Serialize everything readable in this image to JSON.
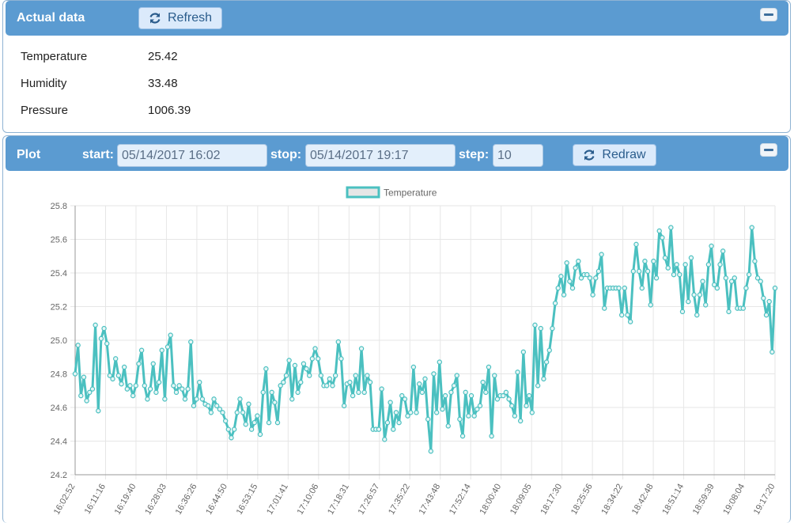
{
  "actual": {
    "title": "Actual data",
    "refresh_label": "Refresh",
    "rows": [
      {
        "label": "Temperature",
        "value": "25.42"
      },
      {
        "label": "Humidity",
        "value": "33.48"
      },
      {
        "label": "Pressure",
        "value": "1006.39"
      }
    ]
  },
  "plot": {
    "title": "Plot",
    "start_label": "start:",
    "start_value": "05/14/2017 16:02",
    "stop_label": "stop:",
    "stop_value": "05/14/2017 19:17",
    "step_label": "step:",
    "step_value": "10",
    "redraw_label": "Redraw"
  },
  "colors": {
    "header": "#5b9bd1",
    "line": "#4bc0c0",
    "grid": "#e6e6e6"
  },
  "chart_data": {
    "type": "line",
    "legend_position": "top",
    "grid": true,
    "ylim": [
      24.2,
      25.8
    ],
    "y_ticks": [
      "25.8",
      "25.6",
      "25.4",
      "25.2",
      "25.0",
      "24.8",
      "24.6",
      "24.4",
      "24.2"
    ],
    "x_tick_labels": [
      "16:02:52",
      "16:11:16",
      "16:19:40",
      "16:28:03",
      "16:36:26",
      "16:44:50",
      "16:53:15",
      "17:01:41",
      "17:10:06",
      "17:18:31",
      "17:26:57",
      "17:35:22",
      "17:43:48",
      "17:52:14",
      "18:00:40",
      "18:09:05",
      "18:17:30",
      "18:25:56",
      "18:34:22",
      "18:42:48",
      "18:51:14",
      "18:59:39",
      "19:08:04",
      "19:17:20"
    ],
    "series": [
      {
        "name": "Temperature",
        "values": [
          24.8,
          24.97,
          24.67,
          24.78,
          24.64,
          24.69,
          24.71,
          25.09,
          24.58,
          25.01,
          25.07,
          24.98,
          24.79,
          24.77,
          24.89,
          24.79,
          24.74,
          24.84,
          24.71,
          24.73,
          24.67,
          24.73,
          24.86,
          24.94,
          24.73,
          24.65,
          24.71,
          24.86,
          24.69,
          24.75,
          24.94,
          24.65,
          24.96,
          25.03,
          24.73,
          24.69,
          24.73,
          24.71,
          24.65,
          24.71,
          24.99,
          24.61,
          24.65,
          24.75,
          24.65,
          24.62,
          24.61,
          24.57,
          24.65,
          24.61,
          24.59,
          24.57,
          24.52,
          24.47,
          24.42,
          24.47,
          24.57,
          24.65,
          24.57,
          24.5,
          24.62,
          24.47,
          24.51,
          24.55,
          24.44,
          24.69,
          24.83,
          24.51,
          24.69,
          24.63,
          24.51,
          24.73,
          24.75,
          24.79,
          24.88,
          24.65,
          24.85,
          24.69,
          24.75,
          24.86,
          24.83,
          24.79,
          24.89,
          24.95,
          24.89,
          24.79,
          24.73,
          24.73,
          24.77,
          24.73,
          24.79,
          24.99,
          24.89,
          24.61,
          24.74,
          24.75,
          24.67,
          24.79,
          24.69,
          24.95,
          24.69,
          24.79,
          24.75,
          24.47,
          24.47,
          24.47,
          24.71,
          24.41,
          24.51,
          24.63,
          24.47,
          24.57,
          24.51,
          24.67,
          24.65,
          24.55,
          24.57,
          24.84,
          24.57,
          24.74,
          24.69,
          24.77,
          24.53,
          24.34,
          24.8,
          24.57,
          24.87,
          24.59,
          24.67,
          24.49,
          24.69,
          24.73,
          24.79,
          24.53,
          24.43,
          24.69,
          24.55,
          24.67,
          24.55,
          24.59,
          24.61,
          24.75,
          24.69,
          24.84,
          24.43,
          24.79,
          24.65,
          24.67,
          24.67,
          24.69,
          24.65,
          24.61,
          24.55,
          24.81,
          24.52,
          24.93,
          24.61,
          24.67,
          24.57,
          25.09,
          24.73,
          25.07,
          24.77,
          24.87,
          24.94,
          25.07,
          25.22,
          25.31,
          25.38,
          25.27,
          25.46,
          25.35,
          25.31,
          25.43,
          25.47,
          25.37,
          25.39,
          25.39,
          25.37,
          25.27,
          25.37,
          25.41,
          25.51,
          25.19,
          25.31,
          25.31,
          25.31,
          25.31,
          25.31,
          25.15,
          25.31,
          25.15,
          25.11,
          25.41,
          25.57,
          25.41,
          25.31,
          25.47,
          25.41,
          25.21,
          25.47,
          25.37,
          25.65,
          25.61,
          25.49,
          25.43,
          25.67,
          25.39,
          25.45,
          25.39,
          25.17,
          25.45,
          25.23,
          25.49,
          25.27,
          25.15,
          25.27,
          25.35,
          25.21,
          25.45,
          25.56,
          25.33,
          25.31,
          25.45,
          25.53,
          25.37,
          25.17,
          25.35,
          25.37,
          25.19,
          25.19,
          25.19,
          25.31,
          25.39,
          25.67,
          25.47,
          25.37,
          25.35,
          25.25,
          25.15,
          25.23,
          24.93,
          25.31
        ]
      }
    ]
  }
}
